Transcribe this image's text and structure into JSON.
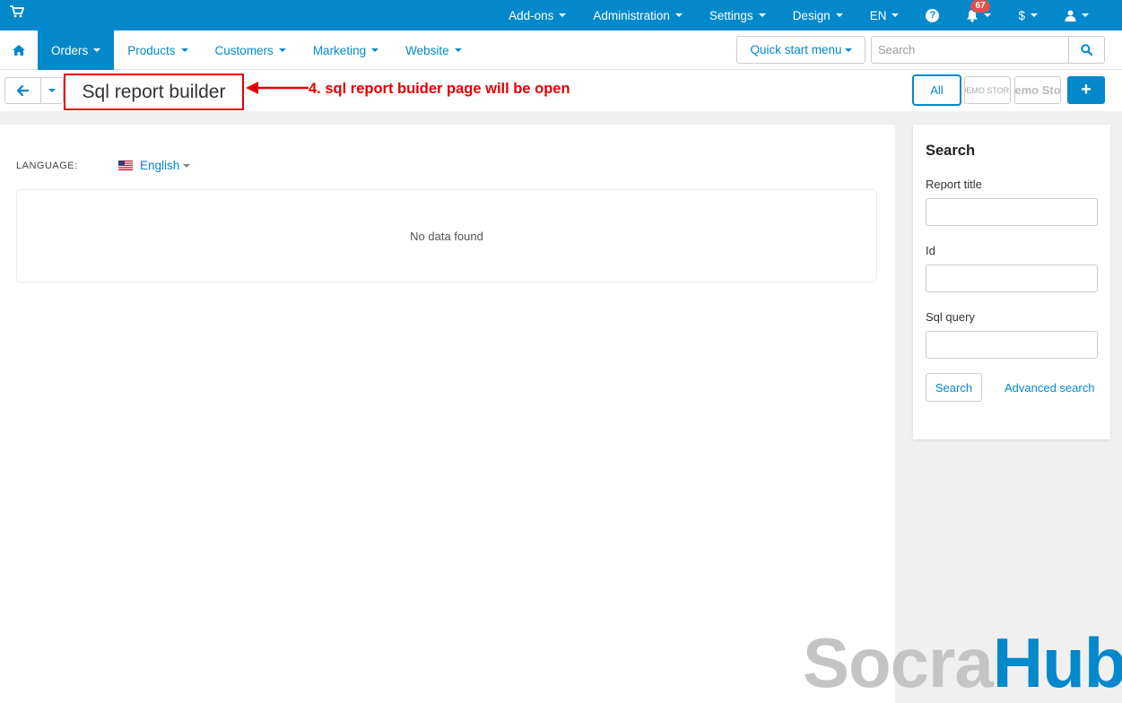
{
  "colors": {
    "primary": "#0388cc",
    "annotation": "#e10000",
    "badge": "#d9534f"
  },
  "topbar": {
    "items": [
      {
        "label": "Add-ons"
      },
      {
        "label": "Administration"
      },
      {
        "label": "Settings"
      },
      {
        "label": "Design"
      },
      {
        "label": "EN"
      }
    ],
    "notification_count": "67",
    "currency": "$",
    "icons": [
      "cart-icon",
      "help-icon",
      "bell-icon",
      "user-icon"
    ]
  },
  "nav": {
    "items": [
      {
        "label": "Orders",
        "active": true
      },
      {
        "label": "Products"
      },
      {
        "label": "Customers"
      },
      {
        "label": "Marketing"
      },
      {
        "label": "Website"
      }
    ],
    "quick_start": "Quick start menu",
    "search_placeholder": "Search"
  },
  "titlebar": {
    "title": "Sql report builder",
    "annotation": "4. sql report buider page will be open",
    "all_label": "All",
    "store1": "DEMO STORE",
    "store2": "emo Sto",
    "add_label": "+"
  },
  "content": {
    "language_label": "LANGUAGE:",
    "language_value": "English",
    "empty_text": "No data found"
  },
  "sidebar": {
    "title": "Search",
    "fields": [
      {
        "label": "Report title",
        "value": ""
      },
      {
        "label": "Id",
        "value": ""
      },
      {
        "label": "Sql query",
        "value": ""
      }
    ],
    "search_button": "Search",
    "advanced_link": "Advanced search"
  },
  "watermark": {
    "part1": "Socra",
    "part2": "Hub"
  }
}
